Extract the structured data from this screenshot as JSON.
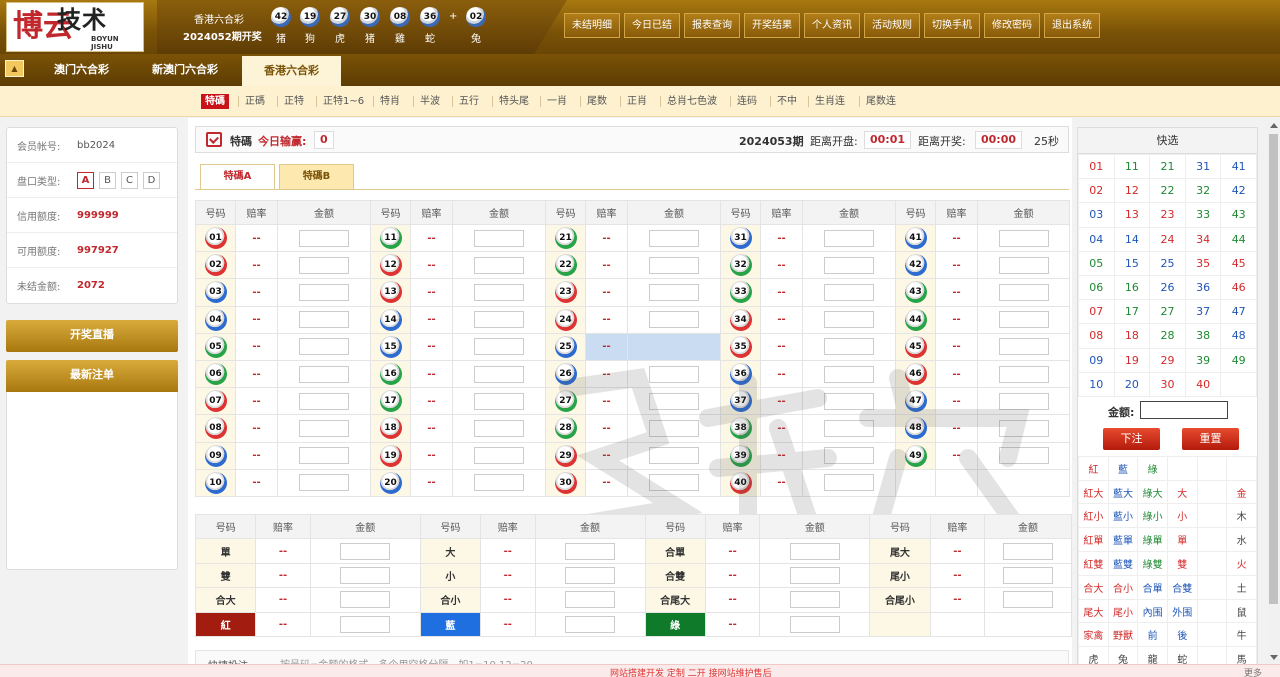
{
  "logo": {
    "mark": "博云",
    "word": "技术",
    "sub1": "BOYUN",
    "sub2": "JISHU"
  },
  "draw": {
    "title": "香港六合彩",
    "period": "2024052期开奖",
    "balls": [
      {
        "num": "42",
        "zodiac": "猪"
      },
      {
        "num": "19",
        "zodiac": "狗"
      },
      {
        "num": "27",
        "zodiac": "虎"
      },
      {
        "num": "30",
        "zodiac": "猪"
      },
      {
        "num": "08",
        "zodiac": "雞"
      },
      {
        "num": "36",
        "zodiac": "蛇"
      }
    ],
    "plus": "+",
    "special": {
      "num": "02",
      "zodiac": "兔"
    }
  },
  "topnav": [
    "未结明细",
    "今日已结",
    "报表查询",
    "开奖结果",
    "个人资讯",
    "活动规则",
    "切换手机",
    "修改密码",
    "退出系统"
  ],
  "lotteries": [
    {
      "label": "澳门六合彩",
      "active": false
    },
    {
      "label": "新澳门六合彩",
      "active": false
    },
    {
      "label": "香港六合彩",
      "active": true
    }
  ],
  "subtabs": [
    "特碼",
    "正碼",
    "正特",
    "正特1~6",
    "特肖",
    "半波",
    "五行",
    "特头尾",
    "一肖",
    "尾数",
    "正肖",
    "总肖七色波",
    "连码",
    "不中",
    "生肖连",
    "尾数连"
  ],
  "account": {
    "member_label": "会员帐号:",
    "member": "bb2024",
    "type_label": "盘口类型:",
    "types": [
      "A",
      "B",
      "C",
      "D"
    ],
    "credit_label": "信用额度:",
    "credit": "999999",
    "avail_label": "可用额度:",
    "avail": "997927",
    "unsettled_label": "未结金额:",
    "unsettled": "2072"
  },
  "live_btn": "开奖直播",
  "latest_btn": "最新注单",
  "header": {
    "game": "特碼",
    "pl_label": "今日输赢:",
    "pl": "0",
    "period": "2024053期",
    "close_label": "距离开盘:",
    "close": "00:01",
    "open_label": "距离开奖:",
    "open": "00:00",
    "countdown": "25秒"
  },
  "tabs": [
    "特碼A",
    "特碼B"
  ],
  "cols": {
    "num": "号码",
    "odds": "赔率",
    "amount": "金额"
  },
  "odds_placeholder": "--",
  "colors": {
    "red": [
      "01",
      "02",
      "07",
      "08",
      "12",
      "13",
      "18",
      "19",
      "23",
      "24",
      "29",
      "30",
      "34",
      "35",
      "40",
      "45",
      "46"
    ],
    "blue": [
      "03",
      "04",
      "09",
      "10",
      "14",
      "15",
      "20",
      "25",
      "26",
      "31",
      "36",
      "37",
      "41",
      "42",
      "47",
      "48"
    ],
    "green": [
      "05",
      "06",
      "11",
      "16",
      "17",
      "21",
      "22",
      "27",
      "28",
      "32",
      "33",
      "38",
      "39",
      "43",
      "44",
      "49"
    ]
  },
  "side_rows": [
    [
      {
        "label": "單"
      },
      {
        "label": "大"
      },
      {
        "label": "合單"
      },
      {
        "label": "尾大"
      }
    ],
    [
      {
        "label": "雙"
      },
      {
        "label": "小"
      },
      {
        "label": "合雙"
      },
      {
        "label": "尾小"
      }
    ],
    [
      {
        "label": "合大"
      },
      {
        "label": "合小"
      },
      {
        "label": "合尾大"
      },
      {
        "label": "合尾小"
      }
    ],
    [
      {
        "label": "紅",
        "color": "red"
      },
      {
        "label": "藍",
        "color": "blue"
      },
      {
        "label": "綠",
        "color": "green"
      },
      {
        "label": ""
      }
    ]
  ],
  "quick_input": {
    "label": "快捷投注",
    "hint": "按号码=金额的格式，多个用空格分隔，如1=10 12=20"
  },
  "quickpick": {
    "title": "快选",
    "amount_label": "金额:",
    "bet": "下注",
    "reset": "重置",
    "groups": [
      [
        "紅",
        "藍",
        "綠",
        "",
        "",
        ""
      ],
      [
        "紅大",
        "藍大",
        "綠大",
        "大",
        "",
        "金"
      ],
      [
        "紅小",
        "藍小",
        "綠小",
        "小",
        "",
        "木"
      ],
      [
        "紅單",
        "藍單",
        "綠單",
        "單",
        "",
        "水"
      ],
      [
        "紅雙",
        "藍雙",
        "綠雙",
        "雙",
        "",
        "火"
      ],
      [
        "合大",
        "合小",
        "合單",
        "合雙",
        "",
        "土"
      ],
      [
        "尾大",
        "尾小",
        "內围",
        "外围",
        "",
        "鼠"
      ],
      [
        "家禽",
        "野獸",
        "前",
        "後",
        "",
        "牛"
      ],
      [
        "虎",
        "兔",
        "龍",
        "蛇",
        "",
        "馬"
      ]
    ]
  },
  "footer": {
    "text": "网站搭建开发 定制 二开 接网站维护售后",
    "more": "更多"
  }
}
